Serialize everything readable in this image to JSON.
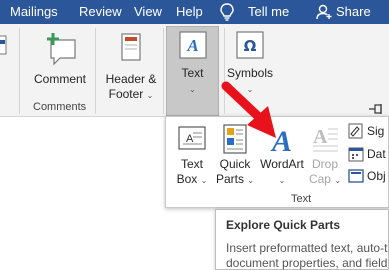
{
  "tabs": [
    {
      "label": "Mailings"
    },
    {
      "label": "Review"
    },
    {
      "label": "View"
    },
    {
      "label": "Help"
    }
  ],
  "tellme": {
    "label": "Tell me"
  },
  "share": {
    "label": "Share"
  },
  "ribbon": {
    "comment": {
      "label": "Comment"
    },
    "comments_group": {
      "label": "Comments"
    },
    "header_footer": {
      "line1": "Header &",
      "line2": "Footer"
    },
    "text": {
      "label": "Text"
    },
    "symbols": {
      "label": "Symbols"
    }
  },
  "panel": {
    "text_box": {
      "line1": "Text",
      "line2": "Box"
    },
    "quick_parts": {
      "line1": "Quick",
      "line2": "Parts"
    },
    "wordart": {
      "label": "WordArt"
    },
    "drop_cap": {
      "line1": "Drop",
      "line2": "Cap"
    },
    "signature": {
      "label": "Sig"
    },
    "date": {
      "label": "Dat"
    },
    "object": {
      "label": "Obj"
    },
    "group_label": "Text"
  },
  "tooltip": {
    "title": "Explore Quick Parts",
    "line1": "Insert preformatted text, auto-t",
    "line2": "document properties, and field"
  },
  "colors": {
    "accent": "#2b579a",
    "arrow": "#e8121d",
    "wordart": "#2b6cc4"
  }
}
